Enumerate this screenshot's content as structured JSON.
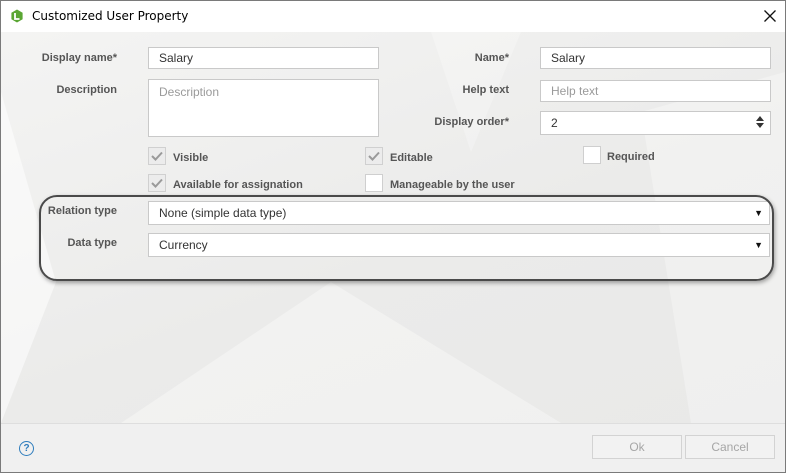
{
  "window": {
    "title": "Customized User Property",
    "app_icon": "app-logo-icon",
    "close_icon": "close-icon"
  },
  "form": {
    "display_name": {
      "label": "Display name*",
      "value": "Salary"
    },
    "name": {
      "label": "Name*",
      "value": "Salary"
    },
    "description": {
      "label": "Description",
      "value": "",
      "placeholder": "Description"
    },
    "help_text": {
      "label": "Help text",
      "value": "",
      "placeholder": "Help text"
    },
    "display_order": {
      "label": "Display order*",
      "value": "2"
    },
    "checkboxes": {
      "visible": {
        "label": "Visible",
        "checked": true
      },
      "editable": {
        "label": "Editable",
        "checked": true
      },
      "required": {
        "label": "Required",
        "checked": false
      },
      "available_for_assignation": {
        "label": "Available for assignation",
        "checked": true
      },
      "manageable_by_user": {
        "label": "Manageable by the user",
        "checked": false
      }
    },
    "relation_type": {
      "label": "Relation type",
      "selected": "None (simple data type)"
    },
    "data_type": {
      "label": "Data type",
      "selected": "Currency"
    }
  },
  "footer": {
    "help_icon": "question-circle-icon",
    "help_glyph": "?",
    "ok_label": "Ok",
    "cancel_label": "Cancel"
  },
  "colors": {
    "accent": "#2f7dbd",
    "app_icon_green": "#5aa633",
    "highlight_border": "#4a4a4a"
  }
}
